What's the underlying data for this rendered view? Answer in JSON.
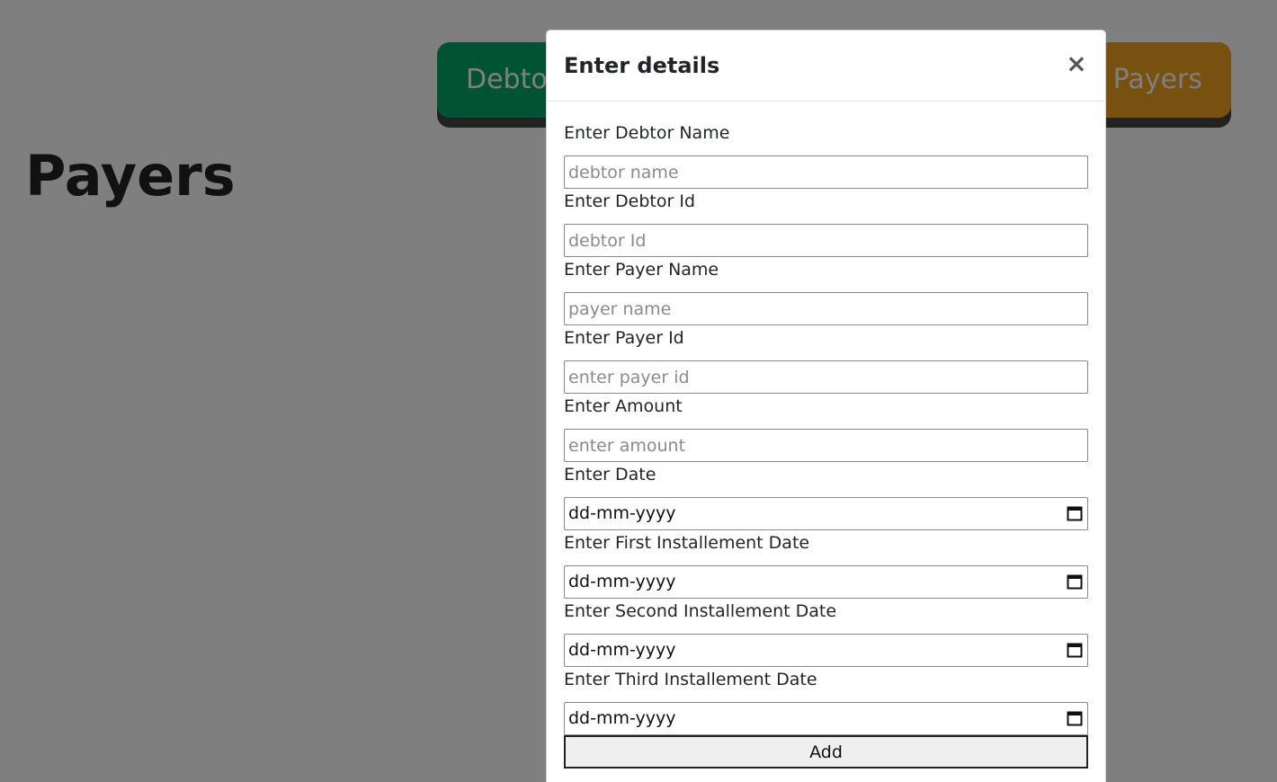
{
  "header": {
    "debtor_button_label": "Debtors",
    "payers_button_label": "Enter Payers",
    "debtor_button_color": "#00a86b",
    "payers_button_color": "#f0a01e"
  },
  "page": {
    "title": "Payers"
  },
  "modal": {
    "title": "Enter details",
    "close_label": "×",
    "fields": [
      {
        "label": "Enter Debtor Name",
        "placeholder": "debtor name",
        "value": ""
      },
      {
        "label": "Enter Debtor Id",
        "placeholder": "debtor Id",
        "value": ""
      },
      {
        "label": "Enter Payer Name",
        "placeholder": "payer name",
        "value": ""
      },
      {
        "label": "Enter Payer Id",
        "placeholder": "enter payer id",
        "value": ""
      },
      {
        "label": "Enter Amount",
        "placeholder": "enter amount",
        "value": ""
      }
    ],
    "date_fields": [
      {
        "label": "Enter Date",
        "display": "dd-mm-yyyy",
        "icon": "calendar-icon"
      },
      {
        "label": "Enter First Installement Date",
        "display": "dd-mm-yyyy",
        "icon": "calendar-icon"
      },
      {
        "label": "Enter Second Installement Date",
        "display": "dd-mm-yyyy",
        "icon": "calendar-icon"
      },
      {
        "label": "Enter Third Installement Date",
        "display": "dd-mm-yyyy",
        "icon": "calendar-icon"
      }
    ],
    "submit_label": "Add"
  }
}
